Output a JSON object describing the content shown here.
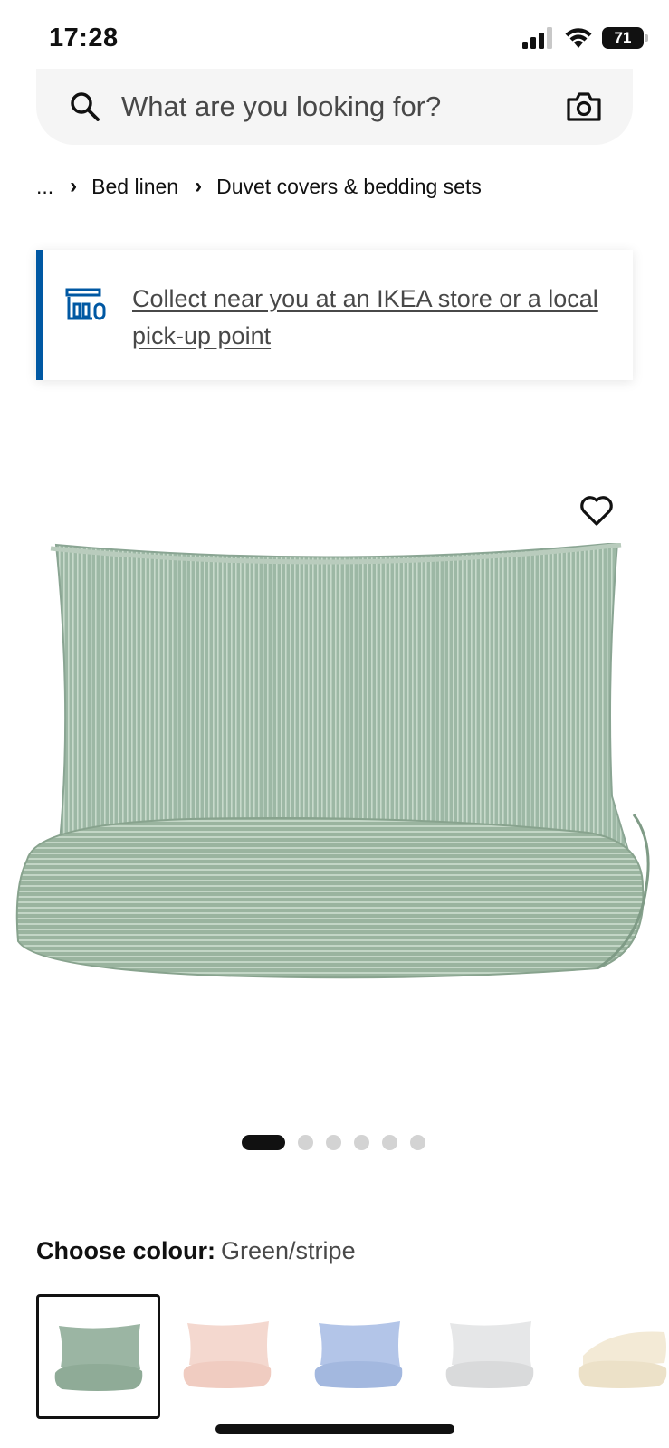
{
  "status_bar": {
    "time": "17:28",
    "battery": "71"
  },
  "search": {
    "placeholder": "What are you looking for?"
  },
  "breadcrumb": {
    "ellipsis": "...",
    "items": [
      "Bed linen",
      "Duvet covers & bedding sets"
    ]
  },
  "pickup_banner": {
    "link_text": "Collect near you at an IKEA store or a local pick-up point",
    "accent_color": "#0058a3"
  },
  "carousel": {
    "total": 6,
    "active": 1
  },
  "colour_selector": {
    "label": "Choose colour:",
    "selected": "Green/stripe",
    "swatches": [
      {
        "name": "green-stripe",
        "color": "#9bb5a3",
        "selected": true
      },
      {
        "name": "pink",
        "color": "#f2cfc4"
      },
      {
        "name": "blue",
        "color": "#a9bde3"
      },
      {
        "name": "grey",
        "color": "#e2e3e4"
      },
      {
        "name": "cream",
        "color": "#f1e8d4"
      }
    ]
  }
}
